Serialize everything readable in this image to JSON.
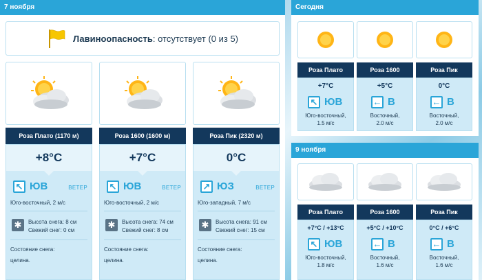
{
  "left": {
    "header": "7 ноября",
    "avalanche": {
      "title": "Лавиноопасность",
      "status": ": отсутствует (0 из 5)"
    },
    "locations": [
      {
        "name": "Роза Плато (1170 м)",
        "temp": "+8°C",
        "dir": "ЮВ",
        "arrow": "↖",
        "wind_label": "ВЕТЕР",
        "wind": "Юго-восточный, 2 м/с",
        "snow_height": "Высота снега: 8 см",
        "fresh_snow": "Свежий снег: 0 см",
        "state_label": "Состояние снега:",
        "state": "целина."
      },
      {
        "name": "Роза 1600 (1600 м)",
        "temp": "+7°C",
        "dir": "ЮВ",
        "arrow": "↖",
        "wind_label": "ВЕТЕР",
        "wind": "Юго-восточный, 2 м/с",
        "snow_height": "Высота снега: 74 см",
        "fresh_snow": "Свежий снег: 8 см",
        "state_label": "Состояние снега:",
        "state": "целина."
      },
      {
        "name": "Роза Пик (2320 м)",
        "temp": "0°C",
        "dir": "ЮЗ",
        "arrow": "↗",
        "wind_label": "ВЕТЕР",
        "wind": "Юго-западный, 7 м/с",
        "snow_height": "Высота снега: 91 см",
        "fresh_snow": "Свежий снег: 15 см",
        "state_label": "Состояние снега:",
        "state": "целина."
      }
    ]
  },
  "today": {
    "header": "Сегодня",
    "locations": [
      {
        "name": "Роза Плато",
        "temp": "+7°C",
        "dir": "ЮВ",
        "arrow": "↖",
        "wind1": "Юго-восточный,",
        "wind2": "1.5 м/с"
      },
      {
        "name": "Роза 1600",
        "temp": "+5°C",
        "dir": "В",
        "arrow": "←",
        "wind1": "Восточный,",
        "wind2": "2.0 м/с"
      },
      {
        "name": "Роза Пик",
        "temp": "0°C",
        "dir": "В",
        "arrow": "←",
        "wind1": "Восточный,",
        "wind2": "2.0 м/с"
      }
    ]
  },
  "nov9": {
    "header": "9 ноября",
    "locations": [
      {
        "name": "Роза Плато",
        "temp": "+7°C / +13°C",
        "dir": "ЮВ",
        "arrow": "↖",
        "wind1": "Юго-восточный,",
        "wind2": "1.8 м/с"
      },
      {
        "name": "Роза 1600",
        "temp": "+5°C / +10°C",
        "dir": "В",
        "arrow": "←",
        "wind1": "Восточный,",
        "wind2": "1.6 м/с"
      },
      {
        "name": "Роза Пик",
        "temp": "0°C / +6°C",
        "dir": "В",
        "arrow": "←",
        "wind1": "Восточный,",
        "wind2": "1.6 м/с"
      }
    ]
  },
  "colors": {
    "accent": "#2aa5d8",
    "dark_bar": "#13385c",
    "info_bg": "#cfeaf7"
  },
  "icons": {
    "flag": "flag-icon",
    "sun_cloud": "partly-cloudy-icon",
    "sun": "sun-icon",
    "cloud": "cloud-icon",
    "snow": "snowflake-icon"
  }
}
